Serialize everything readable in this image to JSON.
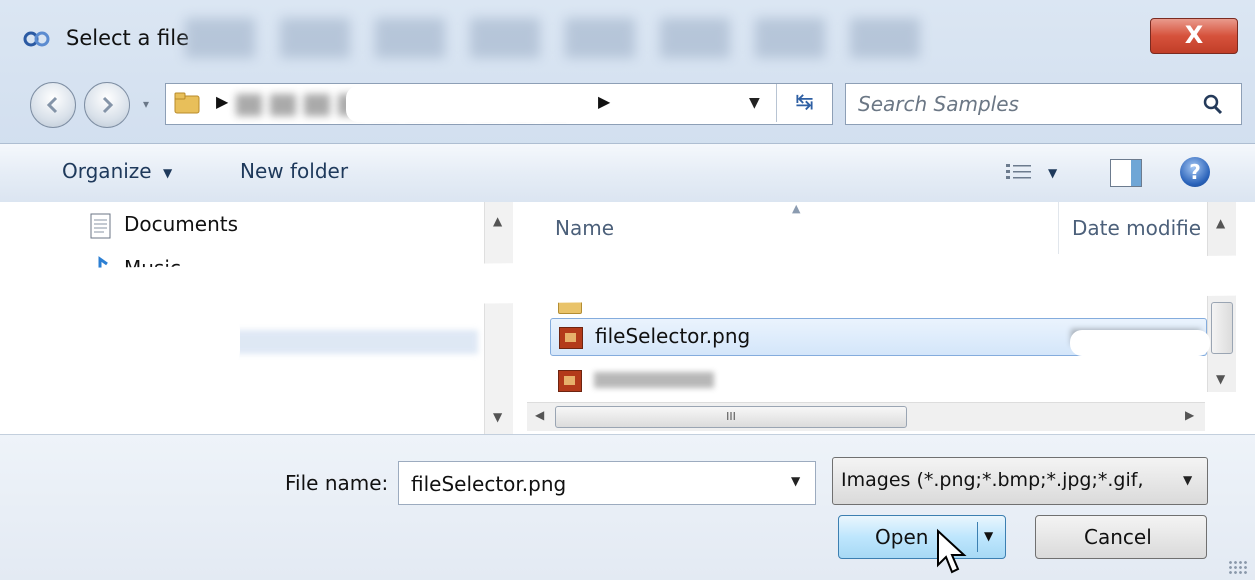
{
  "window": {
    "title": "Select a file",
    "close_glyph": "X"
  },
  "address": {
    "dropdown": "▾",
    "arrow1": "▶",
    "arrow2": "▶"
  },
  "search": {
    "placeholder": "Search Samples"
  },
  "toolbar": {
    "organize": "Organize",
    "organize_caret": "▼",
    "new_folder": "New folder",
    "views_caret": "▼",
    "help": "?"
  },
  "nav_pane": {
    "items": [
      {
        "label": "Documents",
        "icon": "document-icon"
      },
      {
        "label": "Music",
        "icon": "music-note-icon"
      }
    ]
  },
  "file_list": {
    "columns": {
      "name": "Name",
      "date": "Date modifie"
    },
    "rows": [
      {
        "label": "fileSelector.png",
        "selected": true,
        "icon": "image-file-icon"
      }
    ]
  },
  "hscroll": {
    "thumb_glyph": "III"
  },
  "bottom": {
    "file_name_label": "File name:",
    "file_name_value": "fileSelector.png",
    "file_type": "Images (*.png;*.bmp;*.jpg;*.gif,",
    "open": "Open",
    "cancel": "Cancel"
  },
  "colors": {
    "accent": "#3c7fb1",
    "selection": "#d4e6fa",
    "close": "#c13e28"
  }
}
